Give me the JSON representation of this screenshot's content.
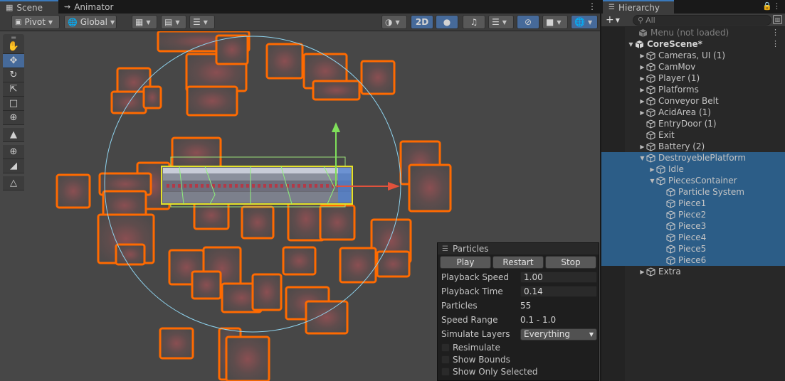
{
  "scene": {
    "tabs": [
      {
        "label": "Scene",
        "icon": "grid-icon"
      },
      {
        "label": "Animator",
        "icon": "animator-icon"
      }
    ],
    "toolbar": {
      "pivot_label": "Pivot",
      "global_label": "Global",
      "mode_2d_label": "2D"
    },
    "tools": [
      "hand-tool-icon",
      "move-tool-icon",
      "rotate-tool-icon",
      "scale-tool-icon",
      "rect-tool-icon",
      "transform-tool-icon",
      "bone-tool-icon",
      "custom-tool-icon",
      "edit-collider-icon",
      "sprite-shape-icon"
    ],
    "accent_selection": "#ff6a00",
    "accent_gizmo_circle": "#8fd3ee"
  },
  "particles": {
    "title": "Particles",
    "buttons": {
      "play": "Play",
      "restart": "Restart",
      "stop": "Stop"
    },
    "fields": {
      "playback_speed_label": "Playback Speed",
      "playback_speed_value": "1.00",
      "playback_time_label": "Playback Time",
      "playback_time_value": "0.14",
      "particles_label": "Particles",
      "particles_value": "55",
      "speed_range_label": "Speed Range",
      "speed_range_value": "0.1 - 1.0",
      "simulate_layers_label": "Simulate Layers",
      "simulate_layers_value": "Everything"
    },
    "checks": {
      "resimulate": "Resimulate",
      "show_bounds": "Show Bounds",
      "show_only_selected": "Show Only Selected"
    }
  },
  "hierarchy": {
    "tab_label": "Hierarchy",
    "search_placeholder": "All",
    "rows": [
      {
        "label": "Menu (not loaded)",
        "depth": 0,
        "kind": "scene-dim"
      },
      {
        "label": "CoreScene*",
        "depth": 0,
        "kind": "scene"
      },
      {
        "label": "Cameras, UI (1)",
        "depth": 1,
        "kind": "go"
      },
      {
        "label": "CamMov",
        "depth": 1,
        "kind": "go"
      },
      {
        "label": "Player (1)",
        "depth": 1,
        "kind": "go"
      },
      {
        "label": "Platforms",
        "depth": 1,
        "kind": "go"
      },
      {
        "label": "Conveyor Belt",
        "depth": 1,
        "kind": "go"
      },
      {
        "label": "AcidArea (1)",
        "depth": 1,
        "kind": "go"
      },
      {
        "label": "EntryDoor (1)",
        "depth": 1,
        "kind": "go"
      },
      {
        "label": "Exit",
        "depth": 1,
        "kind": "go"
      },
      {
        "label": "Battery (2)",
        "depth": 1,
        "kind": "go"
      },
      {
        "label": "DestroyeblePlatform",
        "depth": 1,
        "kind": "go",
        "expanded": true,
        "selected": true
      },
      {
        "label": "Idle",
        "depth": 2,
        "kind": "go",
        "selected": true
      },
      {
        "label": "PiecesContainer",
        "depth": 2,
        "kind": "go",
        "expanded": true,
        "selected": true
      },
      {
        "label": "Particle System",
        "depth": 3,
        "kind": "leaf",
        "selected": true
      },
      {
        "label": "Piece1",
        "depth": 3,
        "kind": "leaf",
        "selected": true
      },
      {
        "label": "Piece2",
        "depth": 3,
        "kind": "leaf",
        "selected": true
      },
      {
        "label": "Piece3",
        "depth": 3,
        "kind": "leaf",
        "selected": true
      },
      {
        "label": "Piece4",
        "depth": 3,
        "kind": "leaf",
        "selected": true
      },
      {
        "label": "Piece5",
        "depth": 3,
        "kind": "leaf",
        "selected": true
      },
      {
        "label": "Piece6",
        "depth": 3,
        "kind": "leaf",
        "selected": true
      },
      {
        "label": "Extra",
        "depth": 1,
        "kind": "go"
      }
    ]
  }
}
